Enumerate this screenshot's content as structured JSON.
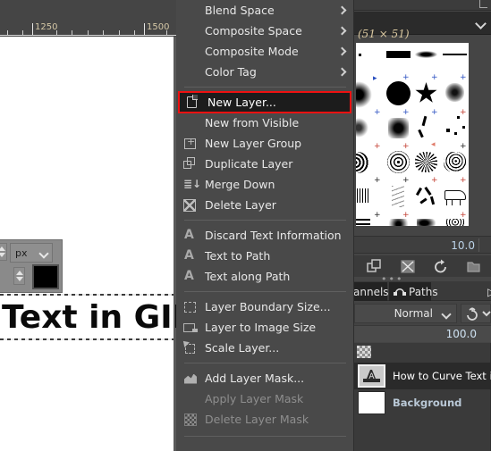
{
  "app": "GIMP",
  "canvas": {
    "ruler": {
      "unit": "px",
      "labels": [
        "1250",
        "1500"
      ]
    },
    "text_layer_content": "Text in GIM",
    "tool_widget": {
      "unit_value": "px"
    },
    "foreground_color": "#000000"
  },
  "context_menu": {
    "items": [
      {
        "label": "Blend Space",
        "icon": "none",
        "submenu": true,
        "enabled": true,
        "highlight": false
      },
      {
        "label": "Composite Space",
        "icon": "none",
        "submenu": true,
        "enabled": true,
        "highlight": false
      },
      {
        "label": "Composite Mode",
        "icon": "none",
        "submenu": true,
        "enabled": true,
        "highlight": false
      },
      {
        "label": "Color Tag",
        "icon": "none",
        "submenu": true,
        "enabled": true,
        "highlight": false
      },
      {
        "separator": true
      },
      {
        "label": "New Layer...",
        "icon": "new-layer-icon",
        "submenu": false,
        "enabled": true,
        "highlight": true
      },
      {
        "label": "New from Visible",
        "icon": "none",
        "submenu": false,
        "enabled": true,
        "highlight": false
      },
      {
        "label": "New Layer Group",
        "icon": "layer-group-icon",
        "submenu": false,
        "enabled": true,
        "highlight": false
      },
      {
        "label": "Duplicate Layer",
        "icon": "duplicate-icon",
        "submenu": false,
        "enabled": true,
        "highlight": false
      },
      {
        "label": "Merge Down",
        "icon": "merge-down-icon",
        "submenu": false,
        "enabled": true,
        "highlight": false
      },
      {
        "label": "Delete Layer",
        "icon": "delete-icon",
        "submenu": false,
        "enabled": true,
        "highlight": false
      },
      {
        "separator": true
      },
      {
        "label": "Discard Text Information",
        "icon": "text-a-icon",
        "submenu": false,
        "enabled": true,
        "highlight": false
      },
      {
        "label": "Text to Path",
        "icon": "text-a-icon",
        "submenu": false,
        "enabled": true,
        "highlight": false
      },
      {
        "label": "Text along Path",
        "icon": "text-a-icon",
        "submenu": false,
        "enabled": true,
        "highlight": false
      },
      {
        "separator": true
      },
      {
        "label": "Layer Boundary Size...",
        "icon": "boundary-icon",
        "submenu": false,
        "enabled": true,
        "highlight": false
      },
      {
        "label": "Layer to Image Size",
        "icon": "image-size-icon",
        "submenu": false,
        "enabled": true,
        "highlight": false
      },
      {
        "label": "Scale Layer...",
        "icon": "scale-icon",
        "submenu": false,
        "enabled": true,
        "highlight": false
      },
      {
        "separator": true
      },
      {
        "label": "Add Layer Mask...",
        "icon": "layer-mask-icon",
        "submenu": false,
        "enabled": true,
        "highlight": false
      },
      {
        "label": "Apply Layer Mask",
        "icon": "none",
        "submenu": false,
        "enabled": false,
        "highlight": false
      },
      {
        "label": "Delete Layer Mask",
        "icon": "checker-icon",
        "submenu": false,
        "enabled": false,
        "highlight": false
      }
    ],
    "highlight_color": "#ee1111"
  },
  "right_dock": {
    "brushes": {
      "size_label": "(51 × 51)"
    },
    "spacing_value": "10.0",
    "brush_toolbar": [
      {
        "name": "duplicate-brush-icon"
      },
      {
        "name": "brush-mask-icon"
      },
      {
        "name": "refresh-brushes-icon"
      },
      {
        "name": "open-brush-icon"
      }
    ],
    "dock_tabs": [
      {
        "label": "annels",
        "icon": "channels-icon",
        "active": false
      },
      {
        "label": "Paths",
        "icon": "paths-icon",
        "active": true
      }
    ],
    "layers": {
      "mode": "Normal",
      "opacity": "100.0",
      "lock_icon": "lock-alpha-icon",
      "items": [
        {
          "name": "How to Curve Text in GI",
          "thumb": "text-layer-thumb",
          "selected": true
        },
        {
          "name": "Background",
          "thumb": "white-thumb",
          "selected": false
        }
      ]
    }
  }
}
